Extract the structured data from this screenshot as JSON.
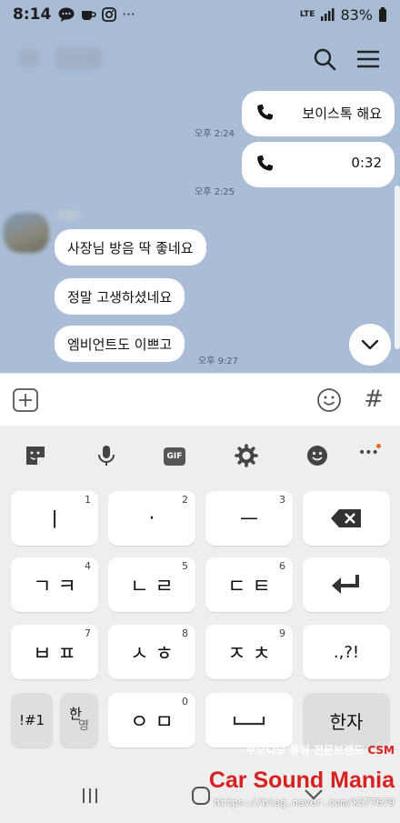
{
  "status_bar": {
    "time": "8:14",
    "network": "LTE",
    "battery": "83%",
    "more": "···"
  },
  "header": {
    "search_icon": "search-icon",
    "menu_icon": "menu-icon"
  },
  "messages": [
    {
      "type": "sent-call",
      "text": "보이스톡 해요",
      "time": "오후 2:24"
    },
    {
      "type": "sent-call",
      "text": "0:32",
      "time": "오후 2:25"
    },
    {
      "type": "received",
      "text": "사장님 방음 딱 좋네요"
    },
    {
      "type": "received",
      "text": "정말 고생하셨네요"
    },
    {
      "type": "received",
      "text": "엠비언트도 이쁘고",
      "time": "오후 9:27"
    }
  ],
  "input_bar": {
    "hash": "#"
  },
  "keyboard": {
    "toolbar": {
      "gif": "GIF",
      "more": "•••"
    },
    "rows": [
      [
        {
          "label": "ㅣ",
          "num": "1"
        },
        {
          "label": "·",
          "num": "2"
        },
        {
          "label": "ㅡ",
          "num": "3"
        }
      ],
      [
        {
          "label": "ㄱ ㅋ",
          "num": "4"
        },
        {
          "label": "ㄴ ㄹ",
          "num": "5"
        },
        {
          "label": "ㄷ ㅌ",
          "num": "6"
        }
      ],
      [
        {
          "label": "ㅂ ㅍ",
          "num": "7"
        },
        {
          "label": "ㅅ ㅎ",
          "num": "8"
        },
        {
          "label": "ㅈ ㅊ",
          "num": "9"
        }
      ],
      [
        {
          "label": "ㅇ ㅁ",
          "num": "0"
        }
      ]
    ],
    "symbols_key": "!#1",
    "lang_key_top": "한",
    "lang_key_bottom": "영",
    "punct_key": ".,?!",
    "hanja_key": "한자"
  },
  "watermark": {
    "subtitle": "무오디오 튜닝 전문브랜드",
    "subtitle_brand": "CSM",
    "title": "Car Sound Mania",
    "url": "https://blog.naver.com/k577679"
  }
}
